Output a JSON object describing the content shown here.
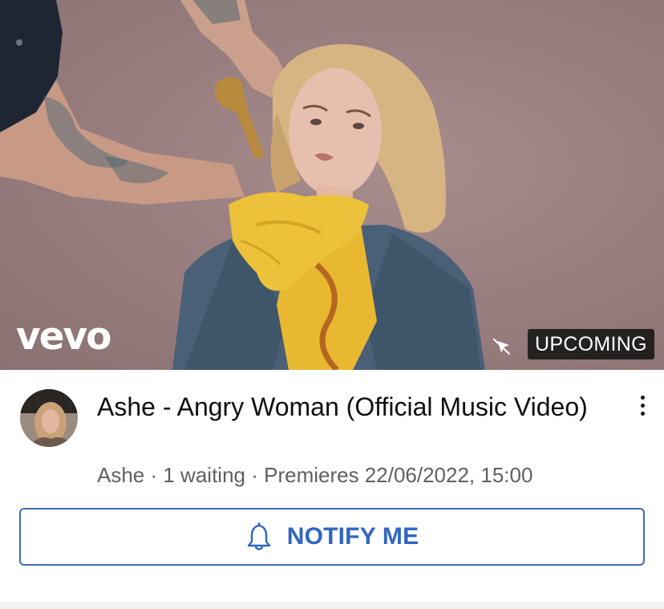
{
  "thumbnail": {
    "logo_text": "vevo",
    "status_badge": "UPCOMING",
    "icons": {
      "cast": "cast-off-icon"
    }
  },
  "video": {
    "title": "Ashe - Angry Woman (Official Music Video)",
    "channel": "Ashe",
    "separator": " · ",
    "waiting": "1 waiting",
    "premiere": "Premieres 22/06/2022, 15:00"
  },
  "actions": {
    "notify_label": "NOTIFY ME",
    "more_icon": "more-vert-icon",
    "bell_icon": "bell-icon"
  },
  "colors": {
    "accent": "#2f66c0",
    "badge_bg": "#141414",
    "meta_text": "#606060"
  }
}
